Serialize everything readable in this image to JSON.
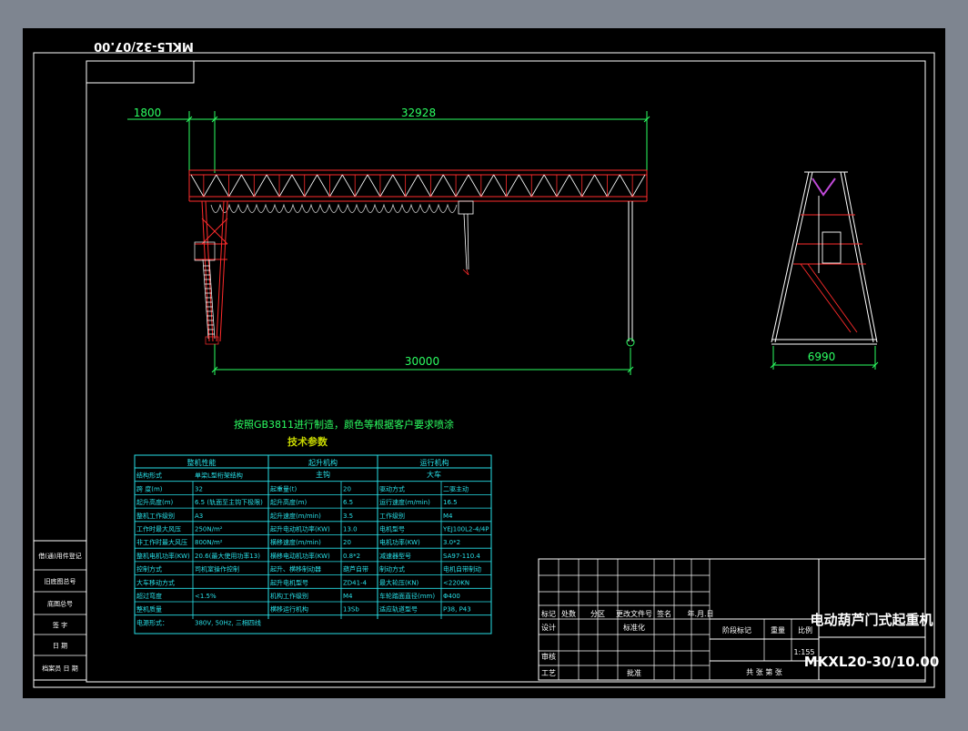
{
  "drawing": {
    "code_mirrored": "MKL5-32/07.00",
    "title": "电动葫芦门式起重机",
    "model": "MKXL20-30/10.00",
    "scale": "1:155",
    "note": "按照GB3811进行制造，颜色等根据客户要求喷涂",
    "params_heading": "技术参数"
  },
  "dimensions": {
    "cantilever": "1800",
    "girder_length": "32928",
    "span": "30000",
    "base_width": "6990"
  },
  "params_table": {
    "groups": [
      "整机性能",
      "起升机构",
      "运行机构"
    ],
    "subgroups": [
      "主钩",
      "大车"
    ],
    "rows": [
      [
        "结构形式",
        "单梁L型桁架结构",
        "",
        "",
        "",
        ""
      ],
      [
        "跨    度(m)",
        "32",
        "起重量(t)",
        "20",
        "驱动方式",
        "二驱主动"
      ],
      [
        "起升高度(m)",
        "6.5 (轨面至主钩下极限)",
        "起升高度(m)",
        "6.5",
        "运行速度(m/min)",
        "16.5"
      ],
      [
        "整机工作级别",
        "A3",
        "起升速度(m/min)",
        "3.5",
        "工作级别",
        "M4"
      ],
      [
        "工作时最大风压",
        "250N/m²",
        "起升电动机功率(KW)",
        "13.0",
        "电机型号",
        "YEJ100L2-4/4P"
      ],
      [
        "非工作时最大风压",
        "800N/m²",
        "横移速度(m/min)",
        "20",
        "电机功率(KW)",
        "3.0*2"
      ],
      [
        "整机电机功率(KW)",
        "20.6(最大使用功率13)",
        "横移电动机功率(KW)",
        "0.8*2",
        "减速器型号",
        "SA97-110.4"
      ],
      [
        "控制方式",
        "司机室操作控制",
        "起升、横移制动器",
        "葫芦自带",
        "制动方式",
        "电机自带制动"
      ],
      [
        "大车移动方式",
        "",
        "起升电机型号",
        "ZD41-4",
        "最大轮压(KN)",
        "<220KN"
      ],
      [
        "超过弯度",
        "<1.5%",
        "机构工作级别",
        "M4",
        "车轮踏面直径(mm)",
        "Φ400"
      ],
      [
        "整机质量",
        "",
        "横移运行机构",
        "13Sb",
        "适应轨道型号",
        "P38, P43"
      ],
      [
        "电源形式：",
        "380V, 50Hz, 三相四线",
        "",
        "",
        "",
        ""
      ]
    ]
  },
  "left_strip": [
    "借(通)用件登记",
    "旧底图总号",
    "底图总号",
    "签    字",
    "日    期",
    "档案员  日  期"
  ],
  "title_block": {
    "rev_headers": [
      "标记",
      "处数",
      "分区",
      "更改文件号",
      "签名",
      "年.月.日"
    ],
    "roles": [
      "设计",
      "标准化",
      "审核",
      "工艺",
      "批准"
    ],
    "stage_headers": [
      "阶段标记",
      "重量",
      "比例"
    ],
    "sheets": "共    张  第    张"
  },
  "colors": {
    "background": "#000000",
    "frame": "#ffffff",
    "structure": "#ff2b2b",
    "dimension": "#2cff62",
    "table": "#28e0e8",
    "title_text": "#ffffff",
    "purple": "#c04ad8",
    "ui_bg": "#7e8590"
  }
}
